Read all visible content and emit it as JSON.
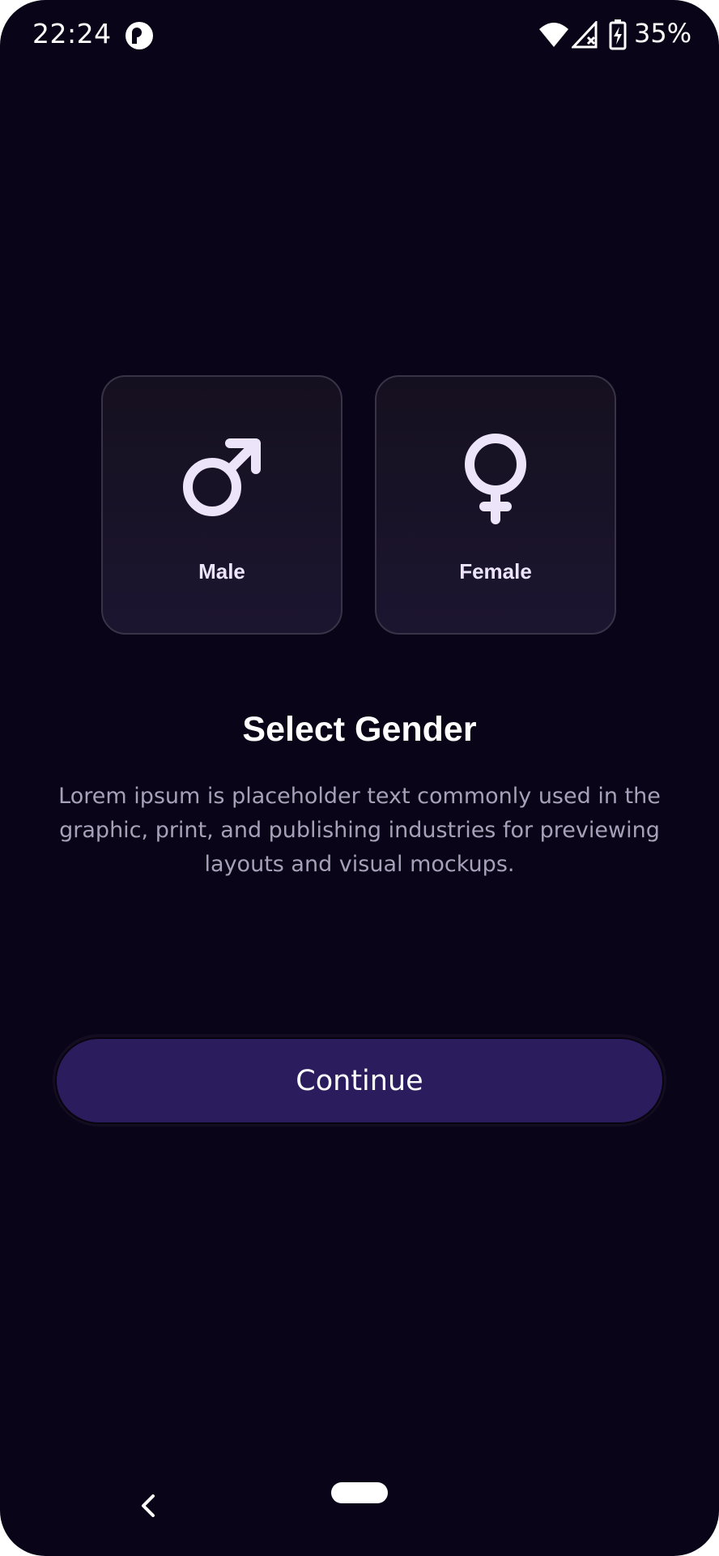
{
  "status_bar": {
    "time": "22:24",
    "battery_percent": "35%",
    "icons": [
      "app-indicator-icon",
      "wifi-icon",
      "signal-icon",
      "battery-charging-icon"
    ]
  },
  "cards": [
    {
      "label": "Male",
      "icon": "male-symbol-icon"
    },
    {
      "label": "Female",
      "icon": "female-symbol-icon"
    }
  ],
  "title": "Select Gender",
  "description": "Lorem ipsum is placeholder text commonly used in the graphic, print, and publishing industries for previewing layouts and visual mockups.",
  "continue_label": "Continue",
  "nav": {
    "icons": [
      "back-icon",
      "home-pill-icon"
    ]
  },
  "colors": {
    "background": "#0a0418",
    "card_border": "#3a3246",
    "icon_tint": "#ece4f8",
    "button": "#2b1c5e",
    "description_text": "#a7a0b9"
  }
}
